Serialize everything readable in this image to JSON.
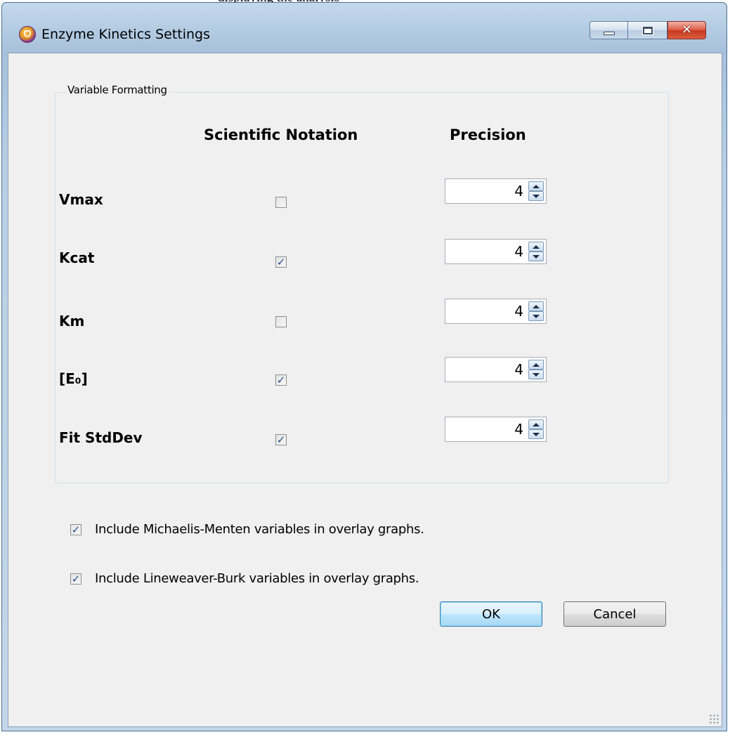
{
  "background_caption": "displaying the analysis",
  "window": {
    "title": "Enzyme Kinetics Settings",
    "controls": {
      "minimize": "minimize",
      "maximize": "maximize",
      "close": "close"
    }
  },
  "group": {
    "legend": "Variable Formatting",
    "columns": {
      "scientific_notation": "Scientific Notation",
      "precision": "Precision"
    },
    "rows": [
      {
        "label": "Vmax",
        "scientific": false,
        "precision": "4"
      },
      {
        "label": "Kcat",
        "scientific": true,
        "precision": "4"
      },
      {
        "label": "Km",
        "scientific": false,
        "precision": "4"
      },
      {
        "label": "[E₀]",
        "scientific": true,
        "precision": "4"
      },
      {
        "label": "Fit StdDev",
        "scientific": true,
        "precision": "4"
      }
    ]
  },
  "options": [
    {
      "label": "Include Michaelis-Menten variables in overlay graphs.",
      "checked": true
    },
    {
      "label": "Include Lineweaver-Burk variables in overlay graphs.",
      "checked": true
    }
  ],
  "buttons": {
    "ok": "OK",
    "cancel": "Cancel"
  },
  "colors": {
    "title_bar": "#b3cbe2",
    "client_bg": "#f0f0f0",
    "close_button": "#c7381f",
    "check": "#2a4d8c"
  }
}
